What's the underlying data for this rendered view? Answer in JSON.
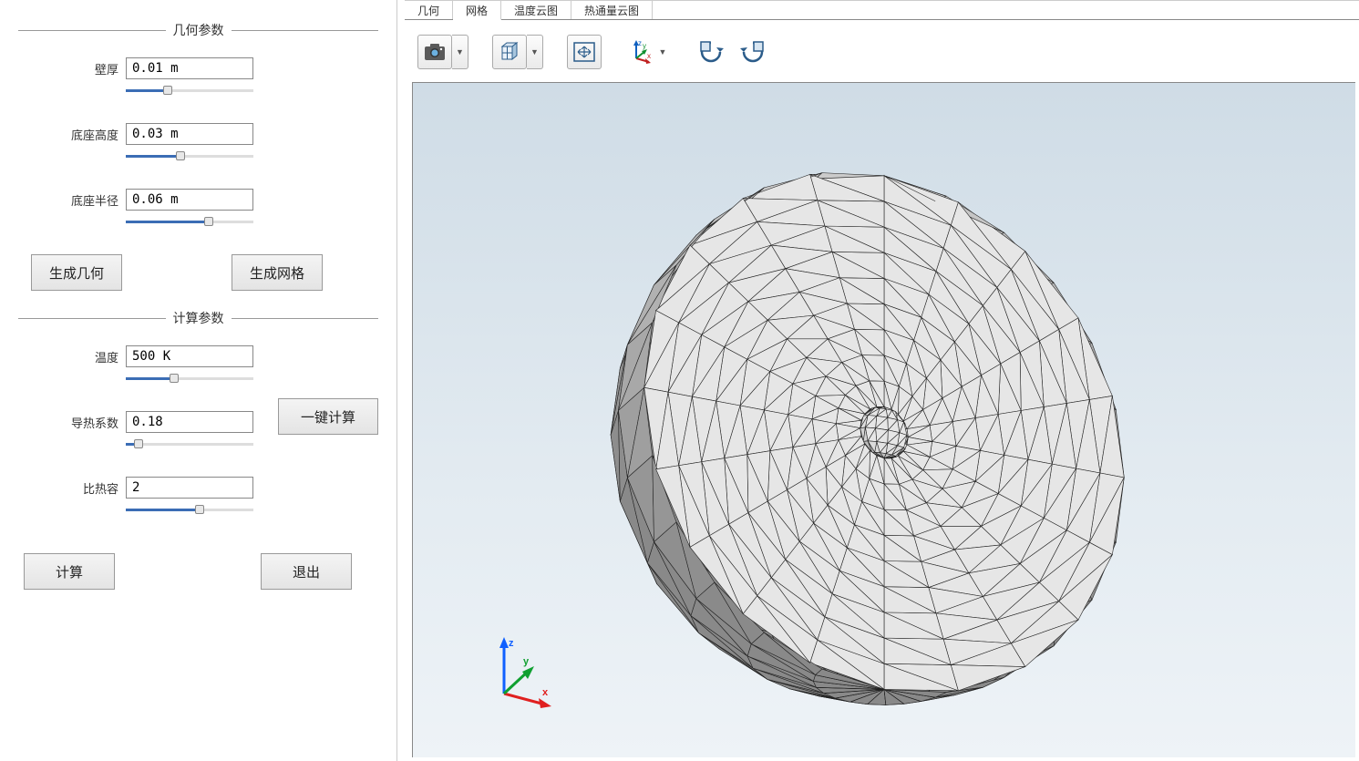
{
  "sidebar": {
    "geom_section_title": "几何参数",
    "calc_section_title": "计算参数",
    "params": {
      "wall_thickness": {
        "label": "壁厚",
        "value": "0.01 m",
        "pct": 33
      },
      "base_height": {
        "label": "底座高度",
        "value": "0.03 m",
        "pct": 43
      },
      "base_radius": {
        "label": "底座半径",
        "value": "0.06 m",
        "pct": 65
      },
      "temperature": {
        "label": "温度",
        "value": "500 K",
        "pct": 38
      },
      "thermal_cond": {
        "label": "导热系数",
        "value": "0.18",
        "pct": 10
      },
      "heat_capacity": {
        "label": "比热容",
        "value": "2",
        "pct": 58
      }
    },
    "buttons": {
      "gen_geom": "生成几何",
      "gen_mesh": "生成网格",
      "one_click": "一键计算",
      "compute": "计算",
      "exit": "退出"
    }
  },
  "tabs": {
    "geometry": "几何",
    "mesh": "网格",
    "temp_contour": "温度云图",
    "flux_contour": "热通量云图",
    "active": "mesh"
  },
  "toolbar_icons": {
    "screenshot": "camera-icon",
    "view_cube": "cube-icon",
    "fit": "fit-icon",
    "axes": "axes-icon",
    "rotate_ccw": "rotate-ccw-icon",
    "rotate_cw": "rotate-cw-icon"
  },
  "triad": {
    "x": "x",
    "y": "y",
    "z": "z"
  }
}
